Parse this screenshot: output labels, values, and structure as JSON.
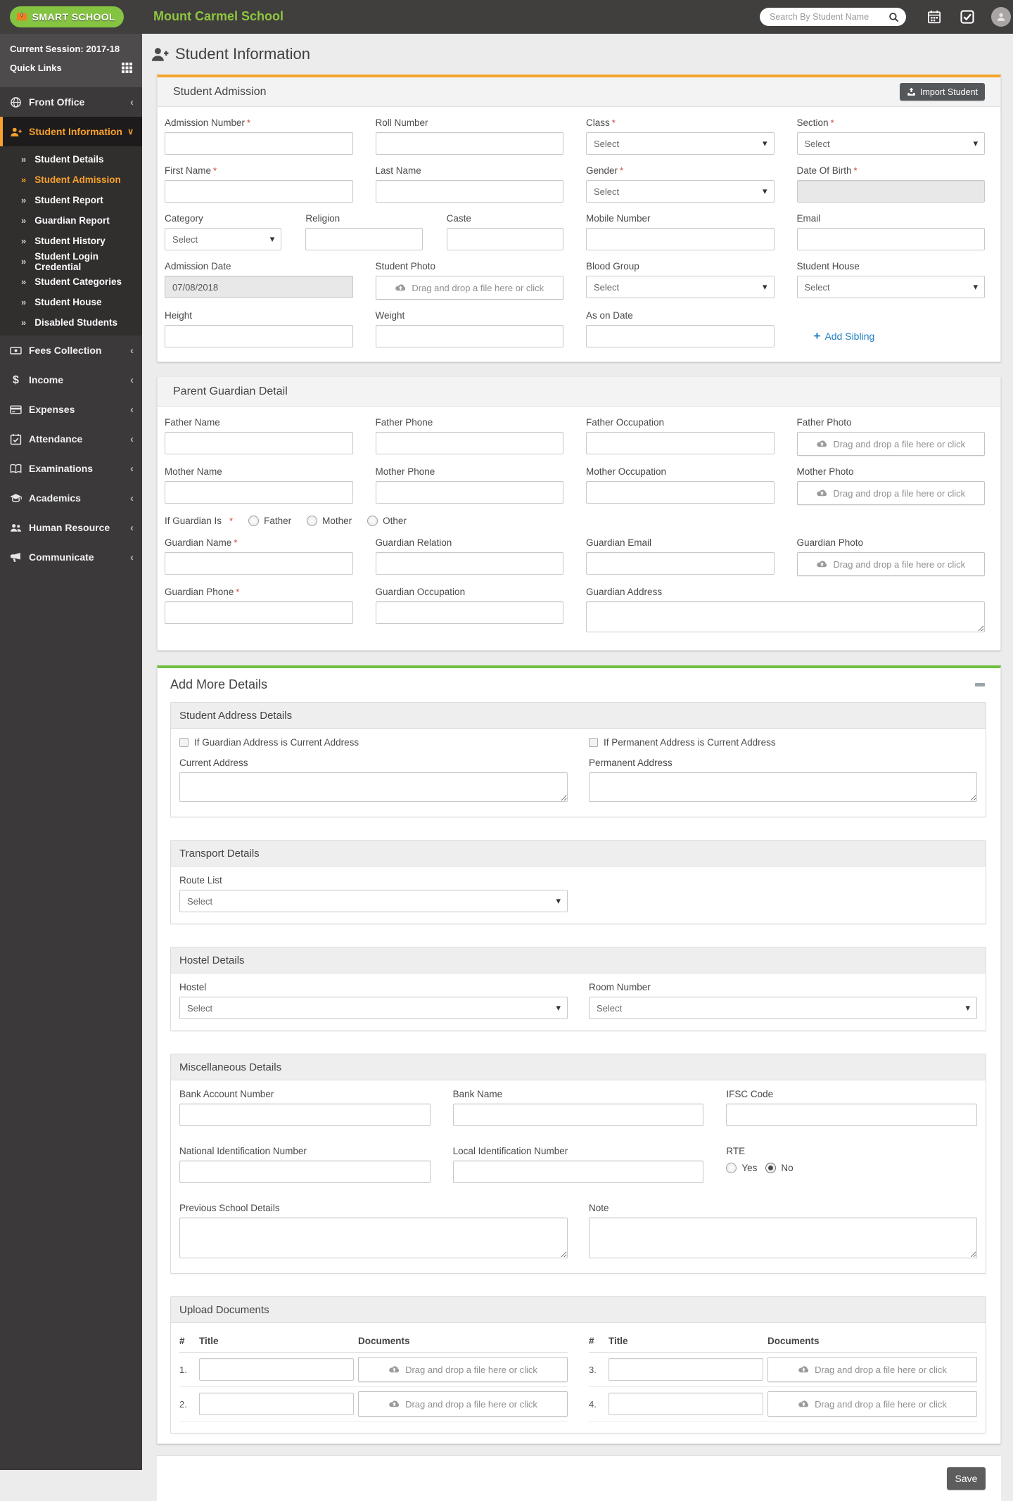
{
  "colors": {
    "orange": "#f5a42c",
    "green": "#71bf44",
    "link_blue": "#2080c0",
    "navbar_dark": "#413e3e",
    "logo_green": "#84c441"
  },
  "required_mark": "*",
  "select_placeholder": "Select",
  "dropzone_text": "Drag and drop a file here or click",
  "navbar": {
    "logo_text": "SMART SCHOOL",
    "school_name": "Mount Carmel School",
    "search_placeholder": "Search By Student Name"
  },
  "sidebar": {
    "session_label": "Current Session: 2017-18",
    "quick_links": "Quick Links",
    "menu": [
      {
        "label": "Front Office",
        "icon": "front-office-icon"
      },
      {
        "label": "Student Information",
        "icon": "student-information-icon",
        "active": true,
        "active_child": "Student Admission",
        "children": [
          "Student Details",
          "Student Admission",
          "Student Report",
          "Guardian Report",
          "Student History",
          "Student Login Credential",
          "Student Categories",
          "Student House",
          "Disabled Students"
        ]
      },
      {
        "label": "Fees Collection",
        "icon": "fees-collection-icon"
      },
      {
        "label": "Income",
        "icon": "income-icon"
      },
      {
        "label": "Expenses",
        "icon": "expenses-icon"
      },
      {
        "label": "Attendance",
        "icon": "attendance-icon"
      },
      {
        "label": "Examinations",
        "icon": "examinations-icon"
      },
      {
        "label": "Academics",
        "icon": "academics-icon"
      },
      {
        "label": "Human Resource",
        "icon": "human-resource-icon"
      },
      {
        "label": "Communicate",
        "icon": "communicate-icon"
      }
    ]
  },
  "page": {
    "title": "Student Information"
  },
  "admission": {
    "title": "Student Admission",
    "import_button": "Import Student",
    "labels": {
      "admission_number": "Admission Number",
      "roll_number": "Roll Number",
      "class": "Class",
      "section": "Section",
      "first_name": "First Name",
      "last_name": "Last Name",
      "gender": "Gender",
      "dob": "Date Of Birth",
      "category": "Category",
      "religion": "Religion",
      "caste": "Caste",
      "mobile": "Mobile Number",
      "email": "Email",
      "admission_date": "Admission Date",
      "student_photo": "Student Photo",
      "blood_group": "Blood Group",
      "student_house": "Student House",
      "height": "Height",
      "weight": "Weight",
      "as_on_date": "As on Date"
    },
    "values": {
      "admission_date": "07/08/2018"
    },
    "add_sibling_plus": "+",
    "add_sibling": "Add Sibling"
  },
  "guardian": {
    "title": "Parent Guardian Detail",
    "labels": {
      "father_name": "Father Name",
      "father_phone": "Father Phone",
      "father_occupation": "Father Occupation",
      "father_photo": "Father Photo",
      "mother_name": "Mother Name",
      "mother_phone": "Mother Phone",
      "mother_occupation": "Mother Occupation",
      "mother_photo": "Mother Photo",
      "if_guardian_is": "If Guardian Is",
      "guardian_name": "Guardian Name",
      "guardian_relation": "Guardian Relation",
      "guardian_email": "Guardian Email",
      "guardian_photo": "Guardian Photo",
      "guardian_phone": "Guardian Phone",
      "guardian_occupation": "Guardian Occupation",
      "guardian_address": "Guardian Address"
    },
    "radio_options": [
      "Father",
      "Mother",
      "Other"
    ],
    "radio_selected": ""
  },
  "more": {
    "title": "Add More Details",
    "address": {
      "title": "Student Address Details",
      "checkbox_guardian": "If Guardian Address is Current Address",
      "checkbox_permanent": "If Permanent Address is Current Address",
      "current_label": "Current Address",
      "permanent_label": "Permanent Address"
    },
    "transport": {
      "title": "Transport Details",
      "route_label": "Route List"
    },
    "hostel": {
      "title": "Hostel Details",
      "hostel_label": "Hostel",
      "room_label": "Room Number"
    },
    "misc": {
      "title": "Miscellaneous Details",
      "bank_account": "Bank Account Number",
      "bank_name": "Bank Name",
      "ifsc": "IFSC Code",
      "national_id": "National Identification Number",
      "local_id": "Local Identification Number",
      "rte": "RTE",
      "rte_yes": "Yes",
      "rte_no": "No",
      "rte_selected": "No",
      "previous_school": "Previous School Details",
      "note": "Note"
    },
    "upload": {
      "title": "Upload Documents",
      "col_number": "#",
      "col_title": "Title",
      "col_documents": "Documents",
      "rows": [
        "1.",
        "2.",
        "3.",
        "4."
      ]
    }
  },
  "footer": {
    "save": "Save"
  }
}
